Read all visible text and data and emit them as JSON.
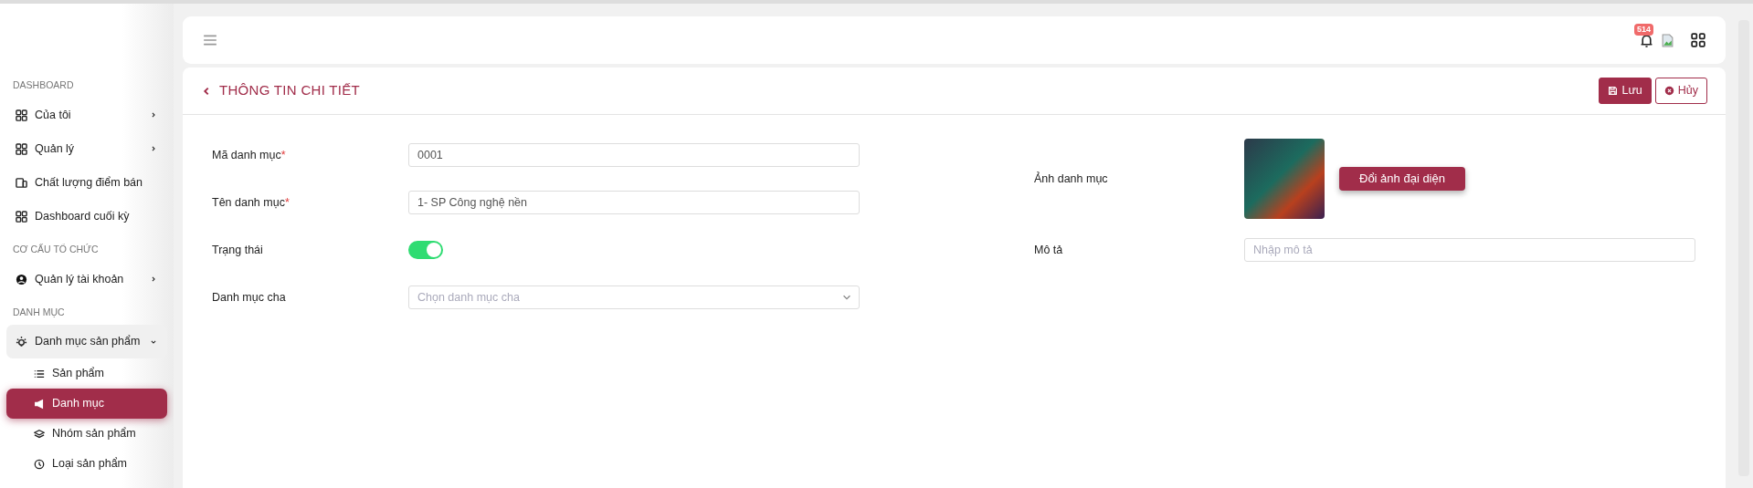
{
  "sidebar": {
    "sections": [
      {
        "title": "DASHBOARD",
        "items": [
          {
            "label": "Của tôi",
            "kind": "group",
            "expanded": false,
            "selected": false
          },
          {
            "label": "Quản lý",
            "kind": "group",
            "expanded": false,
            "selected": false
          },
          {
            "label": "Chất lượng điểm bán",
            "kind": "link",
            "selected": false
          },
          {
            "label": "Dashboard cuối kỳ",
            "kind": "link",
            "selected": false
          }
        ]
      },
      {
        "title": "CƠ CẤU TỔ CHỨC",
        "items": [
          {
            "label": "Quản lý tài khoản",
            "kind": "group",
            "expanded": false,
            "selected": false
          }
        ]
      },
      {
        "title": "DANH MỤC",
        "items": [
          {
            "label": "Danh mục sản phẩm",
            "kind": "group",
            "expanded": true,
            "selected": false,
            "children": [
              {
                "label": "Sản phẩm",
                "selected": false
              },
              {
                "label": "Danh mục",
                "selected": true
              },
              {
                "label": "Nhóm sản phẩm",
                "selected": false
              },
              {
                "label": "Loại sản phẩm",
                "selected": false
              }
            ]
          }
        ]
      }
    ]
  },
  "topbar": {
    "notification_count": "514"
  },
  "page": {
    "title": "THÔNG TIN CHI TIẾT",
    "buttons": [
      {
        "label": "Lưu",
        "kind": "primary"
      },
      {
        "label": "Hủy",
        "kind": "outline"
      }
    ]
  },
  "form": {
    "left": [
      {
        "kind": "text",
        "label": "Mã danh mục",
        "required_mark": "*",
        "value": "0001"
      },
      {
        "kind": "text",
        "label": "Tên danh mục",
        "required_mark": "*",
        "value": "1- SP Công nghệ nền"
      },
      {
        "kind": "toggle",
        "label": "Trạng thái",
        "on": true
      },
      {
        "kind": "select",
        "label": "Danh mục cha",
        "placeholder": "Chọn danh mục cha"
      }
    ],
    "right": [
      {
        "kind": "image",
        "label": "Ảnh danh mục",
        "button": "Đổi ảnh đại diện"
      },
      {
        "kind": "text",
        "label": "Mô tả",
        "placeholder": "Nhập mô tả"
      }
    ]
  }
}
